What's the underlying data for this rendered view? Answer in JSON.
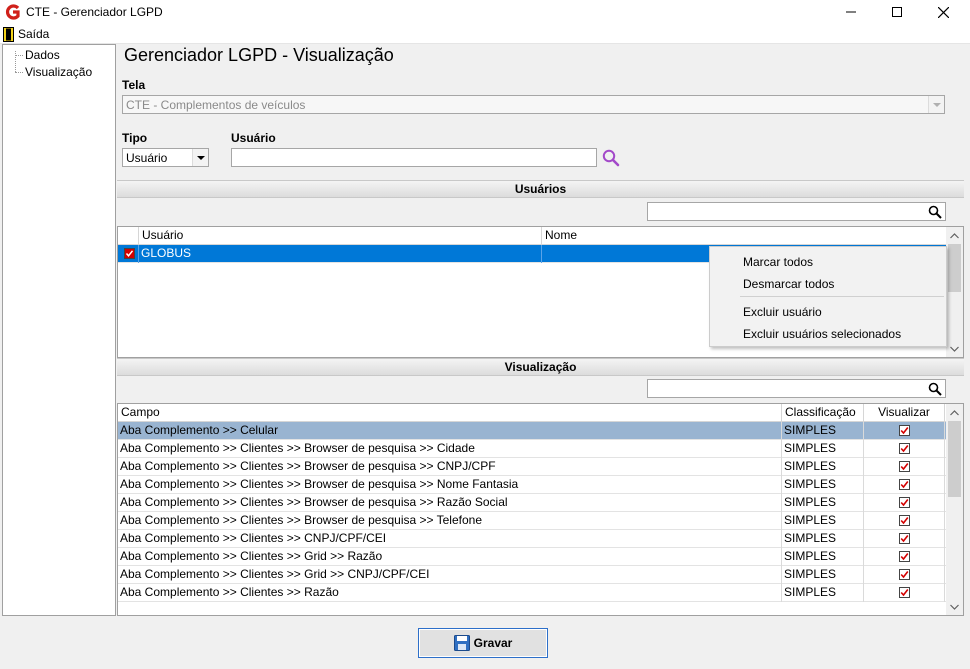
{
  "window": {
    "title": "CTE - Gerenciador LGPD"
  },
  "menu": {
    "saida_label": "Saída"
  },
  "tree": {
    "items": [
      {
        "label": "Dados"
      },
      {
        "label": "Visualização"
      }
    ]
  },
  "main": {
    "title": "Gerenciador LGPD - Visualização",
    "tela_label": "Tela",
    "tela_value": "CTE - Complementos de veículos",
    "tipo_label": "Tipo",
    "tipo_value": "Usuário",
    "usuario_label": "Usuário",
    "usuario_value": ""
  },
  "usuarios_section": {
    "header": "Usuários",
    "search_value": "",
    "columns": [
      "Usuário",
      "Nome"
    ],
    "rows": [
      {
        "usuario": "GLOBUS",
        "nome": "",
        "checked": true
      }
    ]
  },
  "context_menu": {
    "items": [
      "Marcar todos",
      "Desmarcar todos",
      "Excluir usuário",
      "Excluir usuários selecionados"
    ]
  },
  "visualizacao_section": {
    "header": "Visualização",
    "search_value": "",
    "columns": [
      "Campo",
      "Classificação",
      "Visualizar"
    ],
    "rows": [
      {
        "campo": "Aba Complemento >> Celular",
        "classificacao": "SIMPLES",
        "visualizar": true
      },
      {
        "campo": "Aba Complemento >> Clientes >> Browser de pesquisa >> Cidade",
        "classificacao": "SIMPLES",
        "visualizar": true
      },
      {
        "campo": "Aba Complemento >> Clientes >> Browser de pesquisa >> CNPJ/CPF",
        "classificacao": "SIMPLES",
        "visualizar": true
      },
      {
        "campo": "Aba Complemento >> Clientes >> Browser de pesquisa >> Nome Fantasia",
        "classificacao": "SIMPLES",
        "visualizar": true
      },
      {
        "campo": "Aba Complemento >> Clientes >> Browser de pesquisa >> Razão Social",
        "classificacao": "SIMPLES",
        "visualizar": true
      },
      {
        "campo": "Aba Complemento >> Clientes >> Browser de pesquisa >> Telefone",
        "classificacao": "SIMPLES",
        "visualizar": true
      },
      {
        "campo": "Aba Complemento >> Clientes >> CNPJ/CPF/CEI",
        "classificacao": "SIMPLES",
        "visualizar": true
      },
      {
        "campo": "Aba Complemento >> Clientes >> Grid >>  Razão",
        "classificacao": "SIMPLES",
        "visualizar": true
      },
      {
        "campo": "Aba Complemento >> Clientes >> Grid >> CNPJ/CPF/CEI",
        "classificacao": "SIMPLES",
        "visualizar": true
      },
      {
        "campo": "Aba Complemento >> Clientes >> Razão",
        "classificacao": "SIMPLES",
        "visualizar": true
      }
    ]
  },
  "footer": {
    "gravar_label": "Gravar"
  },
  "colors": {
    "selected_row": "#0078d7",
    "highlight_row": "#99b4d1",
    "check_red": "#d40000",
    "search_icon_purple": "#a349c9",
    "logo_red": "#d0201a"
  }
}
